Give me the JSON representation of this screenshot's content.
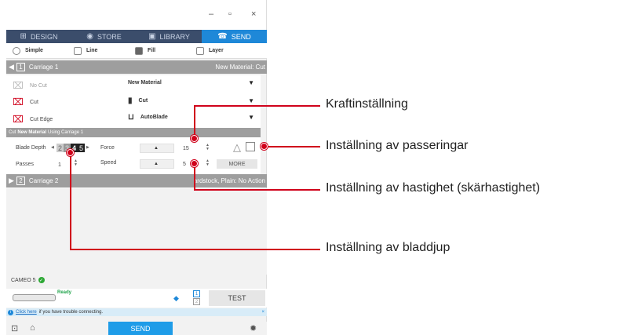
{
  "window": {
    "minimize": "–",
    "restore": "▫",
    "close": "×"
  },
  "tabs": [
    {
      "label": "DESIGN",
      "icon": "⊞"
    },
    {
      "label": "STORE",
      "icon": "◉"
    },
    {
      "label": "LIBRARY",
      "icon": "▣"
    },
    {
      "label": "SEND",
      "icon": "☎"
    }
  ],
  "modes": [
    "Simple",
    "Line",
    "Fill",
    "Layer"
  ],
  "carriage1": {
    "num": "1",
    "label": "Carriage 1",
    "material": "New Material: Cut"
  },
  "actions": [
    "No Cut",
    "Cut",
    "Cut Edge"
  ],
  "selects": {
    "material": "New Material",
    "action": "Cut",
    "tool": "AutoBlade",
    "arrow": "▼"
  },
  "cutbar": {
    "prefix": "Cut",
    "material": "New Material",
    "suffix": "Using Carriage 1"
  },
  "settings": {
    "blade_depth_label": "Blade Depth",
    "blade_digits": [
      "2",
      "3",
      "4",
      "5"
    ],
    "passes_label": "Passes",
    "passes_value": "1",
    "force_label": "Force",
    "force_value": "15",
    "speed_label": "Speed",
    "speed_value": "5",
    "more": "MORE"
  },
  "carriage2": {
    "num": "2",
    "label": "Carriage 2",
    "material": "ardstock, Plain: No Action"
  },
  "device": {
    "name": "CAMEO 5",
    "status": "Ready",
    "slot1": "1",
    "slot2": "2",
    "test": "TEST"
  },
  "info": {
    "link": "Click here",
    "text": "if you have trouble connecting.",
    "close": "×"
  },
  "send": "SEND",
  "callouts": {
    "force": "Kraftinställning",
    "passes": "Inställning av passeringar",
    "speed": "Inställning av hastighet (skärhastighet)",
    "blade": "Inställning av bladdjup"
  },
  "colors": {
    "accent": "#1e88d8",
    "callout": "#d0021b",
    "nav": "#3b4d6b"
  }
}
